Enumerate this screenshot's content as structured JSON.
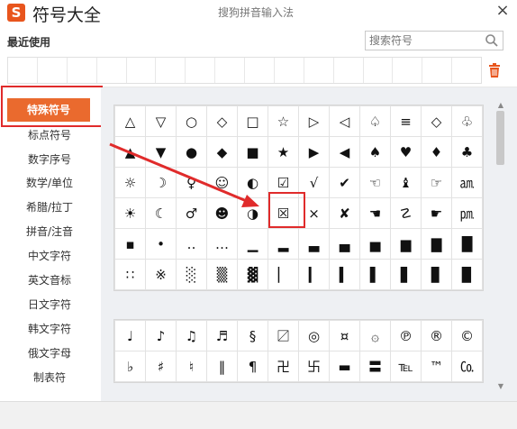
{
  "header": {
    "logo_char": "S",
    "title": "符号大全",
    "subtitle": "搜狗拼音输入法",
    "close_symbol": "×"
  },
  "recent": {
    "label": "最近使用"
  },
  "search": {
    "placeholder": "搜索符号"
  },
  "sidebar": {
    "items": [
      {
        "label": "特殊符号",
        "active": true
      },
      {
        "label": "标点符号"
      },
      {
        "label": "数字序号"
      },
      {
        "label": "数学/单位"
      },
      {
        "label": "希腊/拉丁"
      },
      {
        "label": "拼音/注音"
      },
      {
        "label": "中文字符"
      },
      {
        "label": "英文音标"
      },
      {
        "label": "日文字符"
      },
      {
        "label": "韩文字符"
      },
      {
        "label": "俄文字母"
      },
      {
        "label": "制表符"
      }
    ]
  },
  "grid1": [
    [
      "△",
      "▽",
      "○",
      "◇",
      "□",
      "☆",
      "▷",
      "◁",
      "♤",
      "≡",
      "◇",
      "♧"
    ],
    [
      "▲",
      "▼",
      "●",
      "◆",
      "■",
      "★",
      "▶",
      "◀",
      "♠",
      "♥",
      "♦",
      "♣"
    ],
    [
      "☼",
      "☽",
      "♀",
      "☺",
      "◐",
      "☑",
      "√",
      "✔",
      "☜",
      "♝",
      "☞",
      "㏂"
    ],
    [
      "☀",
      "☾",
      "♂",
      "☻",
      "◑",
      "☒",
      "×",
      "✘",
      "☚",
      "☡",
      "☛",
      "㏘"
    ],
    [
      "▪",
      "•",
      "‥",
      "…",
      "▁",
      "▂",
      "▃",
      "▄",
      "▅",
      "▆",
      "▇",
      "█"
    ],
    [
      "∷",
      "※",
      "░",
      "▒",
      "▓",
      "▏",
      "▎",
      "▍",
      "▌",
      "▋",
      "▊",
      "▉"
    ]
  ],
  "grid2": [
    [
      "♩",
      "♪",
      "♫",
      "♬",
      "§",
      "〼",
      "◎",
      "¤",
      "۞",
      "℗",
      "®",
      "©"
    ],
    [
      "♭",
      "♯",
      "♮",
      "‖",
      "¶",
      "卍",
      "卐",
      "▬",
      "〓",
      "℡",
      "™",
      "㏇"
    ]
  ],
  "colors": {
    "accent": "#ea6a2e",
    "highlight": "#e02b2b",
    "logo": "#e8551d"
  },
  "icons": {
    "search": "search-icon",
    "trash": "trash-icon",
    "close": "close-icon"
  }
}
